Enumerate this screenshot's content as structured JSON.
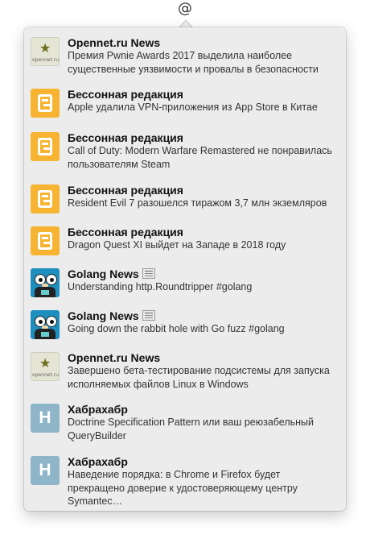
{
  "menubar": {
    "icon_glyph": "@",
    "icon_name": "at-sign-icon"
  },
  "feed": [
    {
      "source": "Opennet.ru News",
      "avatar": "opennet",
      "avatar_label": "opennet.ru",
      "news_icon": false,
      "text": "Премия Pwnie Awards 2017 выделила наиболее существенные уязвимости и провалы в безопасности"
    },
    {
      "source": "Бессонная редакция",
      "avatar": "bessonnaya",
      "news_icon": false,
      "text": "Apple удалила VPN-приложения из App Store в Китае"
    },
    {
      "source": "Бессонная редакция",
      "avatar": "bessonnaya",
      "news_icon": false,
      "text": "Call of Duty: Modern Warfare Remastered не понравилась пользователям Steam"
    },
    {
      "source": "Бессонная редакция",
      "avatar": "bessonnaya",
      "news_icon": false,
      "text": "Resident Evil 7 разошелся тиражом 3,7 млн экземляров"
    },
    {
      "source": "Бессонная редакция",
      "avatar": "bessonnaya",
      "news_icon": false,
      "text": "Dragon Quest XI выйдет на Западе в 2018 году"
    },
    {
      "source": "Golang News",
      "avatar": "golang",
      "news_icon": true,
      "text": "Understanding http.Roundtripper #golang"
    },
    {
      "source": "Golang News",
      "avatar": "golang",
      "news_icon": true,
      "text": "Going down the rabbit hole with Go fuzz #golang"
    },
    {
      "source": "Opennet.ru News",
      "avatar": "opennet",
      "avatar_label": "opennet.ru",
      "news_icon": false,
      "text": "Завершено бета-тестирование подсистемы для запуска исполняемых файлов Linux в Windows"
    },
    {
      "source": "Хабрахабр",
      "avatar": "habr",
      "avatar_letter": "H",
      "news_icon": false,
      "text": "Doctrine Specification Pattern или ваш реюзабельный QueryBuilder"
    },
    {
      "source": "Хабрахабр",
      "avatar": "habr",
      "avatar_letter": "H",
      "news_icon": false,
      "text": "Наведение порядка: в Chrome и Firefox будет прекращено доверие к удостоверяющему центру Symantec…"
    }
  ],
  "colors": {
    "popover_bg": "#ececec",
    "bessonnaya_orange": "#f7b432",
    "habr_blue": "#8eb6c8",
    "golang_blue": "#1d8fbe"
  }
}
